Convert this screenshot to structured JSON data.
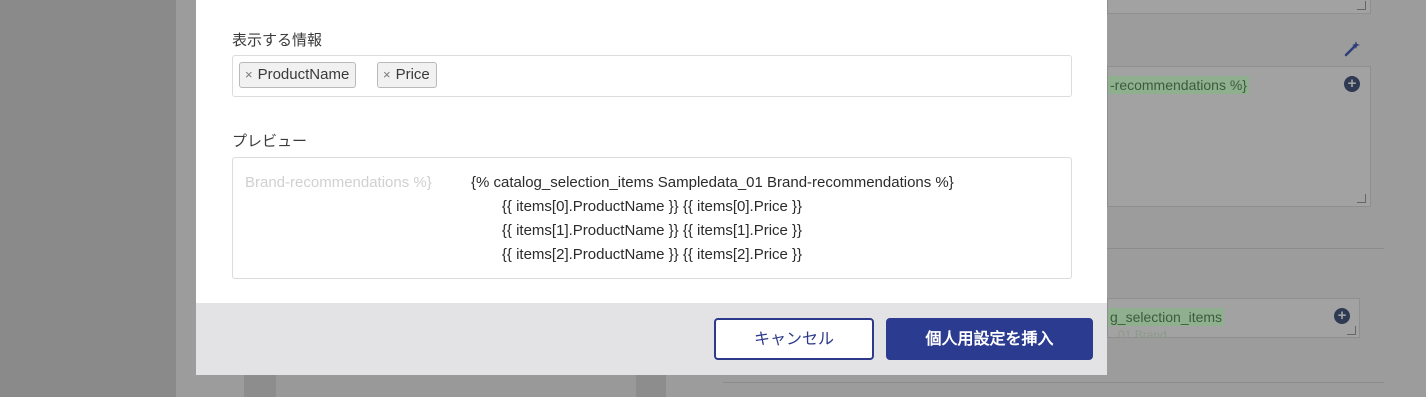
{
  "background": {
    "highlight_1": "-recommendations %}",
    "highlight_2": "g_selection_items",
    "faded_text": "_ 01 Brand"
  },
  "modal": {
    "display_info_label": "表示する情報",
    "tags": [
      {
        "label": "ProductName",
        "remove": "×"
      },
      {
        "label": "Price",
        "remove": "×"
      }
    ],
    "preview_label": "プレビュー",
    "preview_ghost": "Brand-recommendations %}",
    "preview_lines": [
      "{% catalog_selection_items Sampledata_01 Brand-recommendations %}",
      "{{ items[0].ProductName }} {{ items[0].Price }}",
      "{{ items[1].ProductName }} {{ items[1].Price }}",
      "{{ items[2].ProductName }} {{ items[2].Price }}"
    ],
    "cancel_label": "キャンセル",
    "insert_label": "個人用設定を挿入"
  },
  "colors": {
    "primary": "#2b3b8f",
    "footer_bg": "#e3e3e5",
    "overlay": "#8a8a8a"
  },
  "icons": {
    "wand": "magic-wand-icon",
    "plus": "plus-circle-icon",
    "remove": "close-icon"
  }
}
